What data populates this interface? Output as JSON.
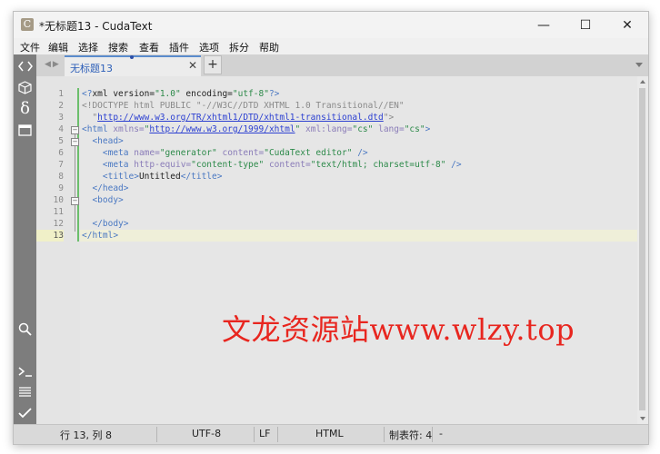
{
  "window": {
    "title": "*无标题13 - CudaText",
    "app_icon_glyph": "C",
    "controls": {
      "minimize": "—",
      "maximize": "☐",
      "close": "✕"
    }
  },
  "menu": [
    "文件",
    "编辑",
    "选择",
    "搜索",
    "查看",
    "插件",
    "选项",
    "拆分",
    "帮助"
  ],
  "sidebar": {
    "top_icons": [
      "code-brackets-icon",
      "cube-icon",
      "delta-icon",
      "panel-icon"
    ],
    "bottom_icons": [
      "search-icon",
      "console-icon",
      "list-icon",
      "check-icon"
    ]
  },
  "tabs": {
    "arrows": "◀▶",
    "active_label": "无标题13",
    "close_glyph": "✕",
    "add_glyph": "+"
  },
  "editor": {
    "line_numbers": [
      "1",
      "2",
      "3",
      "4",
      "5",
      "6",
      "7",
      "8",
      "9",
      "10",
      "11",
      "12",
      "13"
    ],
    "current_line": 13,
    "lines": [
      [
        [
          "tag",
          "<?"
        ],
        [
          "text",
          "xml version="
        ],
        [
          "str",
          "\"1.0\""
        ],
        [
          "text",
          " encoding="
        ],
        [
          "str",
          "\"utf-8\""
        ],
        [
          "tag",
          "?>"
        ]
      ],
      [
        [
          "doc",
          "<!DOCTYPE html PUBLIC \"-//W3C//DTD XHTML 1.0 Transitional//EN\""
        ]
      ],
      [
        [
          "doc",
          "  \""
        ],
        [
          "url",
          "http://www.w3.org/TR/xhtml1/DTD/xhtml1-transitional.dtd"
        ],
        [
          "doc",
          "\">"
        ]
      ],
      [
        [
          "tag",
          "<html "
        ],
        [
          "attr",
          "xmlns="
        ],
        [
          "str",
          "\""
        ],
        [
          "url",
          "http://www.w3.org/1999/xhtml"
        ],
        [
          "str",
          "\""
        ],
        [
          "attr",
          " xml:lang="
        ],
        [
          "str",
          "\"cs\""
        ],
        [
          "attr",
          " lang="
        ],
        [
          "str",
          "\"cs\""
        ],
        [
          "tag",
          ">"
        ]
      ],
      [
        [
          "text",
          "  "
        ],
        [
          "tag",
          "<head>"
        ]
      ],
      [
        [
          "text",
          "    "
        ],
        [
          "tag",
          "<meta "
        ],
        [
          "attr",
          "name="
        ],
        [
          "str",
          "\"generator\""
        ],
        [
          "attr",
          " content="
        ],
        [
          "str",
          "\"CudaText editor\""
        ],
        [
          "tag",
          " />"
        ]
      ],
      [
        [
          "text",
          "    "
        ],
        [
          "tag",
          "<meta "
        ],
        [
          "attr",
          "http-equiv="
        ],
        [
          "str",
          "\"content-type\""
        ],
        [
          "attr",
          " content="
        ],
        [
          "str",
          "\"text/html; charset=utf-8\""
        ],
        [
          "tag",
          " />"
        ]
      ],
      [
        [
          "text",
          "    "
        ],
        [
          "tag",
          "<title>"
        ],
        [
          "text",
          "Untitled"
        ],
        [
          "tag",
          "</title>"
        ]
      ],
      [
        [
          "text",
          "  "
        ],
        [
          "tag",
          "</head>"
        ]
      ],
      [
        [
          "text",
          "  "
        ],
        [
          "tag",
          "<body>"
        ]
      ],
      [
        [
          "text",
          "    "
        ]
      ],
      [
        [
          "text",
          "  "
        ],
        [
          "tag",
          "</body>"
        ]
      ],
      [
        [
          "tag",
          "</html>"
        ]
      ]
    ]
  },
  "watermark": "文龙资源站www.wlzy.top",
  "status": {
    "position": "行 13, 列 8",
    "encoding": "UTF-8",
    "line_ending": "LF",
    "lexer": "HTML",
    "tab_size": "制表符: 4",
    "extra": "-"
  }
}
